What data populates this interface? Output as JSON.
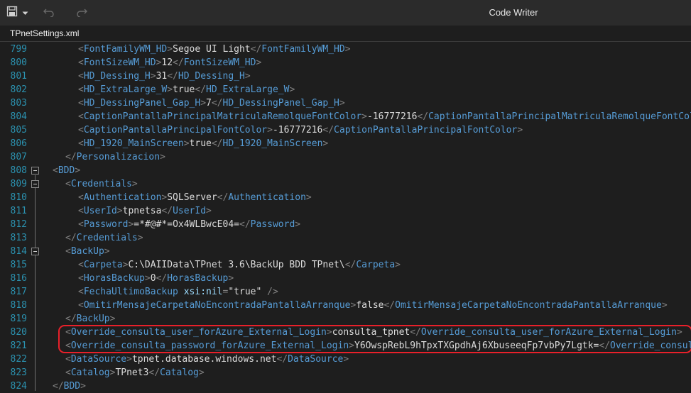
{
  "titlebar": {
    "title": "Code Writer",
    "buttons": [
      {
        "name": "save-icon"
      },
      {
        "name": "chevron-down-icon"
      },
      {
        "name": "undo-icon"
      },
      {
        "name": "redo-icon"
      }
    ]
  },
  "tabs": [
    {
      "label": "TPnetSettings.xml",
      "active": true
    }
  ],
  "colors": {
    "background": "#1e1e1e",
    "line_number": "#2b91af",
    "bracket": "#808080",
    "tag": "#569cd6",
    "text": "#dcdcdc",
    "attribute": "#9cdcfe",
    "attribute_value": "#d69d85",
    "highlight_border": "#e8202a"
  },
  "editor": {
    "lines": [
      {
        "n": "799",
        "indent": 2,
        "tokens": [
          [
            "br",
            "<"
          ],
          [
            "tg",
            "FontFamilyWM_HD"
          ],
          [
            "br",
            ">"
          ],
          [
            "tx",
            "Segoe UI Light"
          ],
          [
            "br",
            "</"
          ],
          [
            "tg",
            "FontFamilyWM_HD"
          ],
          [
            "br",
            ">"
          ]
        ]
      },
      {
        "n": "800",
        "indent": 2,
        "tokens": [
          [
            "br",
            "<"
          ],
          [
            "tg",
            "FontSizeWM_HD"
          ],
          [
            "br",
            ">"
          ],
          [
            "tx",
            "12"
          ],
          [
            "br",
            "</"
          ],
          [
            "tg",
            "FontSizeWM_HD"
          ],
          [
            "br",
            ">"
          ]
        ]
      },
      {
        "n": "801",
        "indent": 2,
        "tokens": [
          [
            "br",
            "<"
          ],
          [
            "tg",
            "HD_Dessing_H"
          ],
          [
            "br",
            ">"
          ],
          [
            "tx",
            "31"
          ],
          [
            "br",
            "</"
          ],
          [
            "tg",
            "HD_Dessing_H"
          ],
          [
            "br",
            ">"
          ]
        ]
      },
      {
        "n": "802",
        "indent": 2,
        "tokens": [
          [
            "br",
            "<"
          ],
          [
            "tg",
            "HD_ExtraLarge_W"
          ],
          [
            "br",
            ">"
          ],
          [
            "tx",
            "true"
          ],
          [
            "br",
            "</"
          ],
          [
            "tg",
            "HD_ExtraLarge_W"
          ],
          [
            "br",
            ">"
          ]
        ]
      },
      {
        "n": "803",
        "indent": 2,
        "tokens": [
          [
            "br",
            "<"
          ],
          [
            "tg",
            "HD_DessingPanel_Gap_H"
          ],
          [
            "br",
            ">"
          ],
          [
            "tx",
            "7"
          ],
          [
            "br",
            "</"
          ],
          [
            "tg",
            "HD_DessingPanel_Gap_H"
          ],
          [
            "br",
            ">"
          ]
        ]
      },
      {
        "n": "804",
        "indent": 2,
        "tokens": [
          [
            "br",
            "<"
          ],
          [
            "tg",
            "CaptionPantallaPrincipalMatriculaRemolqueFontColor"
          ],
          [
            "br",
            ">"
          ],
          [
            "tx",
            "-16777216"
          ],
          [
            "br",
            "</"
          ],
          [
            "tg",
            "CaptionPantallaPrincipalMatriculaRemolqueFontColor"
          ],
          [
            "br",
            ">"
          ]
        ]
      },
      {
        "n": "805",
        "indent": 2,
        "tokens": [
          [
            "br",
            "<"
          ],
          [
            "tg",
            "CaptionPantallaPrincipalFontColor"
          ],
          [
            "br",
            ">"
          ],
          [
            "tx",
            "-16777216"
          ],
          [
            "br",
            "</"
          ],
          [
            "tg",
            "CaptionPantallaPrincipalFontColor"
          ],
          [
            "br",
            ">"
          ]
        ]
      },
      {
        "n": "806",
        "indent": 2,
        "tokens": [
          [
            "br",
            "<"
          ],
          [
            "tg",
            "HD_1920_MainScreen"
          ],
          [
            "br",
            ">"
          ],
          [
            "tx",
            "true"
          ],
          [
            "br",
            "</"
          ],
          [
            "tg",
            "HD_1920_MainScreen"
          ],
          [
            "br",
            ">"
          ]
        ]
      },
      {
        "n": "807",
        "indent": 1,
        "tokens": [
          [
            "br",
            "</"
          ],
          [
            "tg",
            "Personalizacion"
          ],
          [
            "br",
            ">"
          ]
        ]
      },
      {
        "n": "808",
        "indent": 0,
        "fold": true,
        "tokens": [
          [
            "br",
            "<"
          ],
          [
            "tg",
            "BDD"
          ],
          [
            "br",
            ">"
          ]
        ]
      },
      {
        "n": "809",
        "indent": 1,
        "fold": true,
        "tokens": [
          [
            "br",
            "<"
          ],
          [
            "tg",
            "Credentials"
          ],
          [
            "br",
            ">"
          ]
        ]
      },
      {
        "n": "810",
        "indent": 2,
        "tokens": [
          [
            "br",
            "<"
          ],
          [
            "tg",
            "Authentication"
          ],
          [
            "br",
            ">"
          ],
          [
            "tx",
            "SQLServer"
          ],
          [
            "br",
            "</"
          ],
          [
            "tg",
            "Authentication"
          ],
          [
            "br",
            ">"
          ]
        ]
      },
      {
        "n": "811",
        "indent": 2,
        "tokens": [
          [
            "br",
            "<"
          ],
          [
            "tg",
            "UserId"
          ],
          [
            "br",
            ">"
          ],
          [
            "tx",
            "tpnetsa"
          ],
          [
            "br",
            "</"
          ],
          [
            "tg",
            "UserId"
          ],
          [
            "br",
            ">"
          ]
        ]
      },
      {
        "n": "812",
        "indent": 2,
        "tokens": [
          [
            "br",
            "<"
          ],
          [
            "tg",
            "Password"
          ],
          [
            "br",
            ">"
          ],
          [
            "tx",
            "=*#@#*=Ox4WLBwcE04="
          ],
          [
            "br",
            "</"
          ],
          [
            "tg",
            "Password"
          ],
          [
            "br",
            ">"
          ]
        ]
      },
      {
        "n": "813",
        "indent": 1,
        "tokens": [
          [
            "br",
            "</"
          ],
          [
            "tg",
            "Credentials"
          ],
          [
            "br",
            ">"
          ]
        ]
      },
      {
        "n": "814",
        "indent": 1,
        "fold": true,
        "tokens": [
          [
            "br",
            "<"
          ],
          [
            "tg",
            "BackUp"
          ],
          [
            "br",
            ">"
          ]
        ]
      },
      {
        "n": "815",
        "indent": 2,
        "tokens": [
          [
            "br",
            "<"
          ],
          [
            "tg",
            "Carpeta"
          ],
          [
            "br",
            ">"
          ],
          [
            "tx",
            "C:\\DAIIData\\TPnet 3.6\\BackUp BDD TPnet\\"
          ],
          [
            "br",
            "</"
          ],
          [
            "tg",
            "Carpeta"
          ],
          [
            "br",
            ">"
          ]
        ]
      },
      {
        "n": "816",
        "indent": 2,
        "tokens": [
          [
            "br",
            "<"
          ],
          [
            "tg",
            "HorasBackup"
          ],
          [
            "br",
            ">"
          ],
          [
            "tx",
            "0"
          ],
          [
            "br",
            "</"
          ],
          [
            "tg",
            "HorasBackup"
          ],
          [
            "br",
            ">"
          ]
        ]
      },
      {
        "n": "817",
        "indent": 2,
        "tokens": [
          [
            "br",
            "<"
          ],
          [
            "tg",
            "FechaUltimoBackup"
          ],
          [
            "tx",
            " "
          ],
          [
            "at",
            "xsi:nil"
          ],
          [
            "br",
            "="
          ],
          [
            "tx",
            "\"true\""
          ],
          [
            "tx",
            " "
          ],
          [
            "br",
            "/>"
          ]
        ]
      },
      {
        "n": "818",
        "indent": 2,
        "tokens": [
          [
            "br",
            "<"
          ],
          [
            "tg",
            "OmitirMensajeCarpetaNoEncontradaPantallaArranque"
          ],
          [
            "br",
            ">"
          ],
          [
            "tx",
            "false"
          ],
          [
            "br",
            "</"
          ],
          [
            "tg",
            "OmitirMensajeCarpetaNoEncontradaPantallaArranque"
          ],
          [
            "br",
            ">"
          ]
        ]
      },
      {
        "n": "819",
        "indent": 1,
        "tokens": [
          [
            "br",
            "</"
          ],
          [
            "tg",
            "BackUp"
          ],
          [
            "br",
            ">"
          ]
        ]
      },
      {
        "n": "820",
        "indent": 1,
        "tokens": [
          [
            "br",
            "<"
          ],
          [
            "tg",
            "Override_consulta_user_forAzure_External_Login"
          ],
          [
            "br",
            ">"
          ],
          [
            "tx",
            "consulta_tpnet"
          ],
          [
            "br",
            "</"
          ],
          [
            "tg",
            "Override_consulta_user_forAzure_External_Login"
          ],
          [
            "br",
            ">"
          ]
        ]
      },
      {
        "n": "821",
        "indent": 1,
        "tokens": [
          [
            "br",
            "<"
          ],
          [
            "tg",
            "Override_consulta_password_forAzure_External_Login"
          ],
          [
            "br",
            ">"
          ],
          [
            "tx",
            "Y6OwspRebL9hTpxTXGpdhAj6XbuseeqFp7vbPy7Lgtk="
          ],
          [
            "br",
            "</"
          ],
          [
            "tg",
            "Override_consulta_password_forAzure_External_Login"
          ],
          [
            "br",
            ">"
          ]
        ]
      },
      {
        "n": "822",
        "indent": 1,
        "tokens": [
          [
            "br",
            "<"
          ],
          [
            "tg",
            "DataSource"
          ],
          [
            "br",
            ">"
          ],
          [
            "tx",
            "tpnet.database.windows.net"
          ],
          [
            "br",
            "</"
          ],
          [
            "tg",
            "DataSource"
          ],
          [
            "br",
            ">"
          ]
        ]
      },
      {
        "n": "823",
        "indent": 1,
        "tokens": [
          [
            "br",
            "<"
          ],
          [
            "tg",
            "Catalog"
          ],
          [
            "br",
            ">"
          ],
          [
            "tx",
            "TPnet3"
          ],
          [
            "br",
            "</"
          ],
          [
            "tg",
            "Catalog"
          ],
          [
            "br",
            ">"
          ]
        ]
      },
      {
        "n": "824",
        "indent": 0,
        "tokens": [
          [
            "br",
            "</"
          ],
          [
            "tg",
            "BDD"
          ],
          [
            "br",
            ">"
          ]
        ]
      }
    ]
  }
}
